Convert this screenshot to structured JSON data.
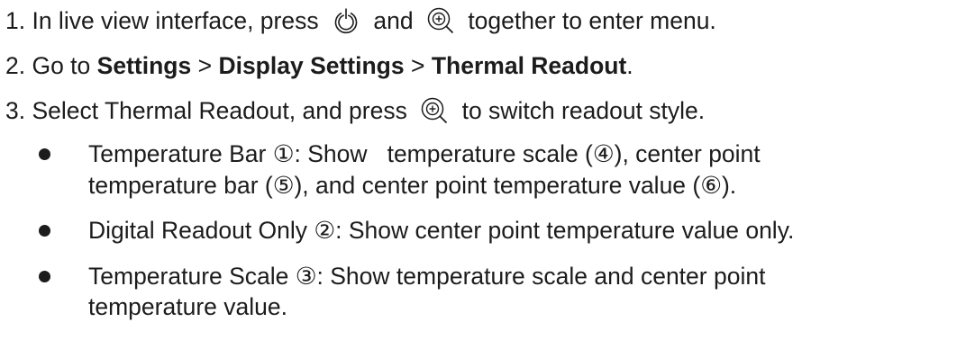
{
  "steps": {
    "step1": {
      "prefix": "1. In live view interface, press",
      "and": "and",
      "suffix": "together to enter menu."
    },
    "step2": {
      "prefix": "2. Go to",
      "settings": "Settings",
      "sep1": ">",
      "display": "Display Settings",
      "sep2": ">",
      "readout": "Thermal Readout",
      "end": "."
    },
    "step3": {
      "prefix": "3. Select Thermal Readout, and press",
      "suffix": "to switch readout style."
    }
  },
  "bullets": {
    "b1": {
      "line1": "Temperature Bar ①: Show   temperature scale (④), center point",
      "line2": "temperature bar (⑤), and center point temperature value (⑥)."
    },
    "b2": {
      "line1": "Digital Readout Only ②: Show center point temperature value only."
    },
    "b3": {
      "line1": "Temperature Scale ③: Show temperature scale and center point",
      "line2": "temperature value."
    }
  },
  "icons": {
    "power": "power-icon",
    "zoom": "zoom-in-icon"
  }
}
